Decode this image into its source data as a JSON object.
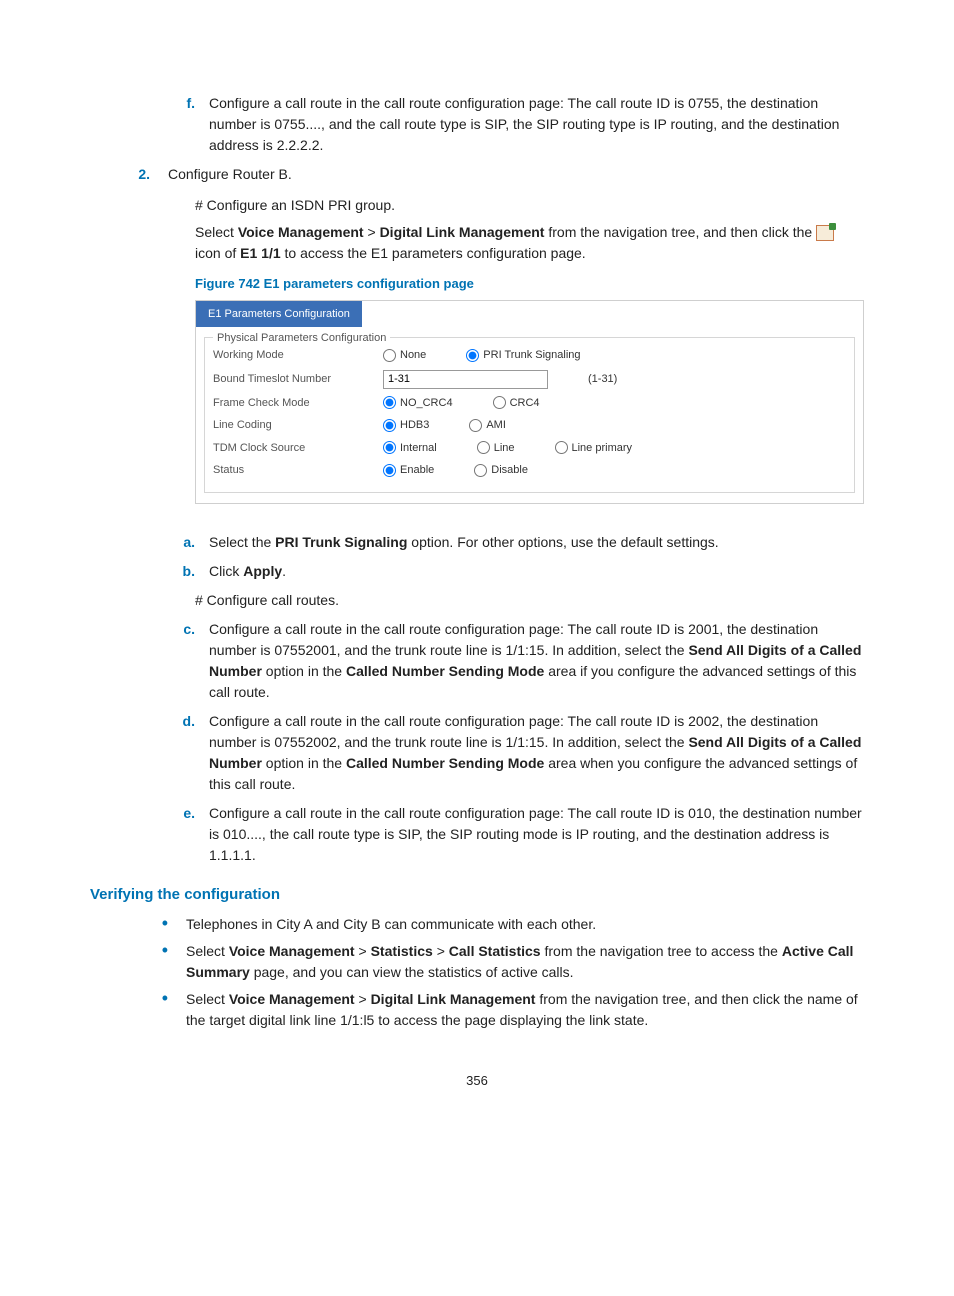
{
  "steps": {
    "f": "Configure a call route in the call route configuration page: The call route ID is 0755, the destination number is 0755...., and the call route type is SIP, the SIP routing type is IP routing, and the destination address is 2.2.2.2.",
    "n2_label": "2.",
    "n2_body": "Configure Router B.",
    "n2_sub1": "# Configure an ISDN PRI group.",
    "n2_sub2_a": "Select ",
    "n2_sub2_b1": "Voice Management",
    "n2_sub2_gt1": " > ",
    "n2_sub2_b2": "Digital Link Management",
    "n2_sub2_c": " from the navigation tree, and then click the ",
    "n2_sub2_d": " icon of ",
    "n2_sub2_b3": "E1 1/1",
    "n2_sub2_e": " to access the E1 parameters configuration page."
  },
  "figure": {
    "caption": "Figure 742 E1 parameters configuration page",
    "tab": "E1 Parameters Configuration",
    "legend": "Physical Parameters Configuration",
    "rows": {
      "workingMode": {
        "label": "Working Mode",
        "opt1": "None",
        "opt2": "PRI Trunk Signaling"
      },
      "bound": {
        "label": "Bound Timeslot Number",
        "value": "1-31",
        "hint": "(1-31)"
      },
      "frame": {
        "label": "Frame Check Mode",
        "opt1": "NO_CRC4",
        "opt2": "CRC4"
      },
      "line": {
        "label": "Line Coding",
        "opt1": "HDB3",
        "opt2": "AMI"
      },
      "tdm": {
        "label": "TDM Clock Source",
        "opt1": "Internal",
        "opt2": "Line",
        "opt3": "Line primary"
      },
      "status": {
        "label": "Status",
        "opt1": "Enable",
        "opt2": "Disable"
      }
    }
  },
  "after": {
    "a_pre": "Select the ",
    "a_b": "PRI Trunk Signaling",
    "a_post": " option. For other options, use the default settings.",
    "b_pre": "Click ",
    "b_b": "Apply",
    "b_post": ".",
    "hash": "# Configure call routes.",
    "c_pre": "Configure a call route in the call route configuration page: The call route ID is 2001, the destination number is 07552001, and the trunk route line is 1/1:15. In addition, select the ",
    "c_b1": "Send All Digits of a Called Number",
    "c_mid": " option in the ",
    "c_b2": "Called Number Sending Mode",
    "c_post": " area if you configure the advanced settings of this call route.",
    "d_pre": "Configure a call route in the call route configuration page: The call route ID is 2002, the destination number is 07552002, and the trunk route line is 1/1:15. In addition, select the ",
    "d_b1": "Send All Digits of a Called Number",
    "d_mid": " option in the ",
    "d_b2": "Called Number Sending Mode",
    "d_post": " area when you configure the advanced settings of this call route.",
    "e": "Configure a call route in the call route configuration page: The call route ID is 010, the destination number is 010...., the call route type is SIP, the SIP routing mode is IP routing, and the destination address is 1.1.1.1."
  },
  "verify": {
    "heading": "Verifying the configuration",
    "b1": "Telephones in City A and City B can communicate with each other.",
    "b2_a": "Select ",
    "b2_b1": "Voice Management",
    "b2_gt1": " > ",
    "b2_b2": "Statistics",
    "b2_gt2": " > ",
    "b2_b3": "Call Statistics",
    "b2_c": " from the navigation tree to access the ",
    "b2_b4": "Active Call Summary",
    "b2_d": " page, and you can view the statistics of active calls.",
    "b3_a": "Select ",
    "b3_b1": "Voice Management",
    "b3_gt1": " > ",
    "b3_b2": "Digital Link Management",
    "b3_c": " from the navigation tree, and then click the name of the target digital link line 1/1:l5 to access the page displaying the link state."
  },
  "pagenum": "356"
}
